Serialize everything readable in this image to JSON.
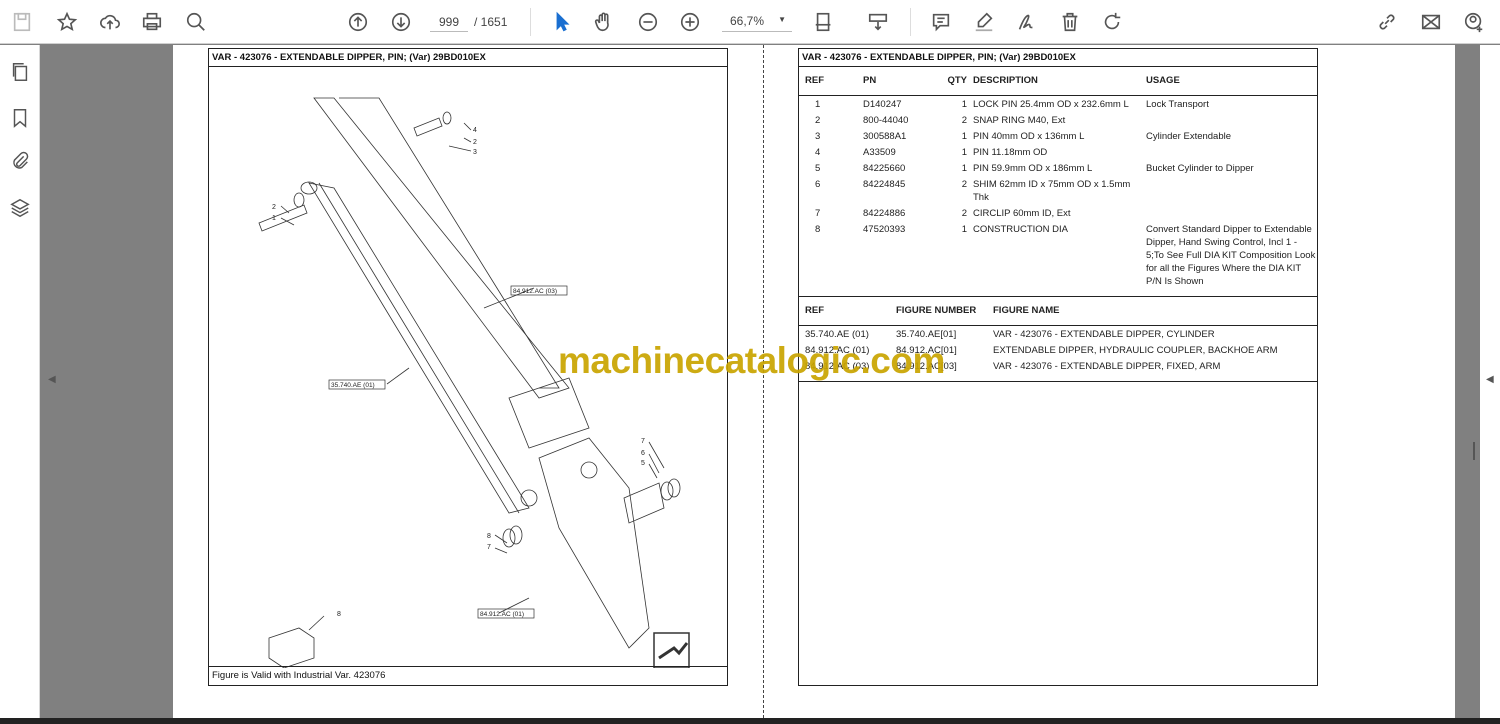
{
  "toolbar": {
    "page_current": "999",
    "page_total": "/ 1651",
    "zoom": "66,7%",
    "icons": [
      "save-icon",
      "bookmark-star-icon",
      "upload-icon",
      "print-icon",
      "zoom-search-icon",
      "page-up-icon",
      "page-down-icon",
      "select-cursor-icon",
      "hand-icon",
      "zoom-out-icon",
      "zoom-in-icon",
      "fit-page-icon",
      "scroll-mode-icon",
      "comment-icon",
      "highlight-icon",
      "sign-icon",
      "delete-icon",
      "rotate-icon",
      "share-link-icon",
      "email-icon",
      "add-user-icon"
    ]
  },
  "sidebar": {
    "icons": [
      "pages-icon",
      "bookmarks-icon",
      "attachments-icon",
      "layers-icon"
    ]
  },
  "left_page": {
    "title": "VAR - 423076 - EXTENDABLE DIPPER, PIN; (Var) 29BD010EX",
    "footer": "Figure is Valid with Industrial Var. 423076",
    "callouts": {
      "c4": "4",
      "c2a": "2",
      "c3": "3",
      "c2b": "2",
      "c1": "1",
      "c7a": "7",
      "c6": "6",
      "c5": "5",
      "c8a": "8",
      "c7b": "7",
      "c8": "8"
    },
    "refs": {
      "r1": "84.912.AC (03)",
      "r2": "35.740.AE (01)",
      "r3": "84.912.AC (01)"
    }
  },
  "right_page": {
    "title": "VAR - 423076 - EXTENDABLE DIPPER, PIN; (Var) 29BD010EX",
    "parts_headers": [
      "REF",
      "PN",
      "QTY",
      "DESCRIPTION",
      "USAGE"
    ],
    "parts": [
      [
        "1",
        "D140247",
        "1",
        "LOCK PIN 25.4mm OD x 232.6mm L",
        "Lock Transport"
      ],
      [
        "2",
        "800-44040",
        "2",
        "SNAP RING M40, Ext",
        ""
      ],
      [
        "3",
        "300588A1",
        "1",
        "PIN 40mm OD x 136mm L",
        "Cylinder Extendable"
      ],
      [
        "4",
        "A33509",
        "1",
        "PIN 11.18mm OD",
        ""
      ],
      [
        "5",
        "84225660",
        "1",
        "PIN 59.9mm OD x 186mm L",
        "Bucket Cylinder to Dipper"
      ],
      [
        "6",
        "84224845",
        "2",
        "SHIM 62mm ID x 75mm OD x 1.5mm Thk",
        ""
      ],
      [
        "7",
        "84224886",
        "2",
        "CIRCLIP 60mm ID, Ext",
        ""
      ],
      [
        "8",
        "47520393",
        "1",
        "CONSTRUCTION DIA",
        "Convert Standard Dipper to Extendable Dipper, Hand Swing Control, Incl 1 - 5;To See Full DIA KIT Composition Look for all the Figures Where the DIA KIT P/N Is Shown"
      ]
    ],
    "fig_headers": [
      "REF",
      "FIGURE NUMBER",
      "FIGURE NAME"
    ],
    "figures": [
      [
        "35.740.AE (01)",
        "35.740.AE[01]",
        "VAR - 423076 - EXTENDABLE DIPPER, CYLINDER"
      ],
      [
        "84.912.AC (01)",
        "84.912.AC[01]",
        "EXTENDABLE DIPPER, HYDRAULIC COUPLER, BACKHOE ARM"
      ],
      [
        "84.912.AC (03)",
        "84.912.AC[03]",
        "VAR - 423076 - EXTENDABLE DIPPER, FIXED, ARM"
      ]
    ]
  },
  "watermark": "machinecatalogic.com"
}
